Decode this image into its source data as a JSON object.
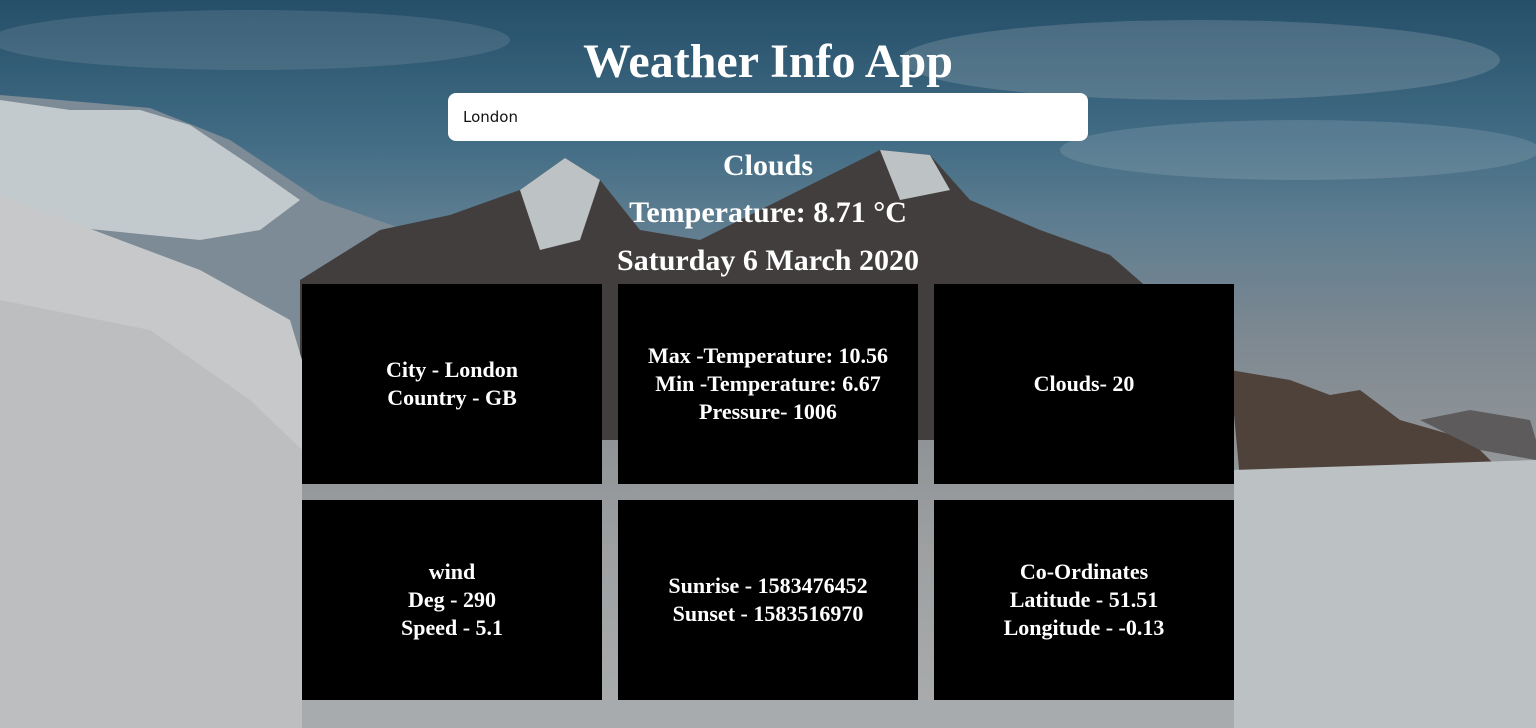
{
  "app": {
    "title": "Weather Info App"
  },
  "search": {
    "value": "London"
  },
  "weather": {
    "main": "Clouds",
    "temperature_text": "Temperature: 8.71 °C",
    "date": "Saturday 6 March 2020"
  },
  "cards": {
    "location": {
      "city": "City - London",
      "country": "Country - GB"
    },
    "temperature": {
      "max": "Max -Temperature: 10.56",
      "min": "Min -Temperature: 6.67",
      "pressure": "Pressure- 1006"
    },
    "clouds": {
      "value": "Clouds- 20"
    },
    "wind": {
      "title": "wind",
      "deg": "Deg - 290",
      "speed": "Speed - 5.1"
    },
    "sun": {
      "sunrise": "Sunrise - 1583476452",
      "sunset": "Sunset - 1583516970"
    },
    "coords": {
      "title": "Co-Ordinates",
      "lat": "Latitude - 51.51",
      "lon": "Longitude - -0.13"
    }
  },
  "colors": {
    "card_background": "#000000",
    "text": "#ffffff",
    "input_background": "#ffffff",
    "sky": "#2b5a78",
    "snow": "#c3c5c6"
  }
}
